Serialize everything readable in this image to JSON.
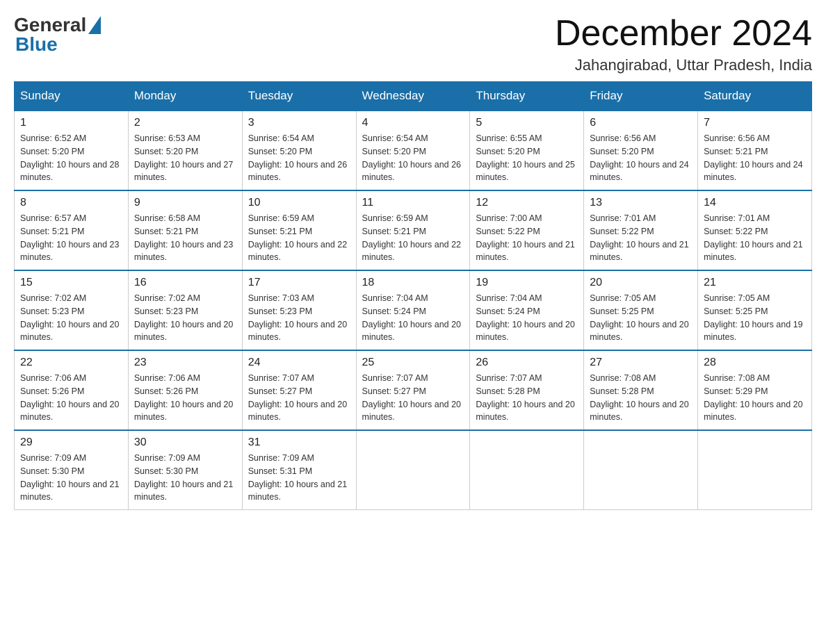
{
  "logo": {
    "general": "General",
    "blue": "Blue"
  },
  "title": {
    "month": "December 2024",
    "location": "Jahangirabad, Uttar Pradesh, India"
  },
  "headers": [
    "Sunday",
    "Monday",
    "Tuesday",
    "Wednesday",
    "Thursday",
    "Friday",
    "Saturday"
  ],
  "weeks": [
    [
      {
        "day": "1",
        "sunrise": "6:52 AM",
        "sunset": "5:20 PM",
        "daylight": "10 hours and 28 minutes."
      },
      {
        "day": "2",
        "sunrise": "6:53 AM",
        "sunset": "5:20 PM",
        "daylight": "10 hours and 27 minutes."
      },
      {
        "day": "3",
        "sunrise": "6:54 AM",
        "sunset": "5:20 PM",
        "daylight": "10 hours and 26 minutes."
      },
      {
        "day": "4",
        "sunrise": "6:54 AM",
        "sunset": "5:20 PM",
        "daylight": "10 hours and 26 minutes."
      },
      {
        "day": "5",
        "sunrise": "6:55 AM",
        "sunset": "5:20 PM",
        "daylight": "10 hours and 25 minutes."
      },
      {
        "day": "6",
        "sunrise": "6:56 AM",
        "sunset": "5:20 PM",
        "daylight": "10 hours and 24 minutes."
      },
      {
        "day": "7",
        "sunrise": "6:56 AM",
        "sunset": "5:21 PM",
        "daylight": "10 hours and 24 minutes."
      }
    ],
    [
      {
        "day": "8",
        "sunrise": "6:57 AM",
        "sunset": "5:21 PM",
        "daylight": "10 hours and 23 minutes."
      },
      {
        "day": "9",
        "sunrise": "6:58 AM",
        "sunset": "5:21 PM",
        "daylight": "10 hours and 23 minutes."
      },
      {
        "day": "10",
        "sunrise": "6:59 AM",
        "sunset": "5:21 PM",
        "daylight": "10 hours and 22 minutes."
      },
      {
        "day": "11",
        "sunrise": "6:59 AM",
        "sunset": "5:21 PM",
        "daylight": "10 hours and 22 minutes."
      },
      {
        "day": "12",
        "sunrise": "7:00 AM",
        "sunset": "5:22 PM",
        "daylight": "10 hours and 21 minutes."
      },
      {
        "day": "13",
        "sunrise": "7:01 AM",
        "sunset": "5:22 PM",
        "daylight": "10 hours and 21 minutes."
      },
      {
        "day": "14",
        "sunrise": "7:01 AM",
        "sunset": "5:22 PM",
        "daylight": "10 hours and 21 minutes."
      }
    ],
    [
      {
        "day": "15",
        "sunrise": "7:02 AM",
        "sunset": "5:23 PM",
        "daylight": "10 hours and 20 minutes."
      },
      {
        "day": "16",
        "sunrise": "7:02 AM",
        "sunset": "5:23 PM",
        "daylight": "10 hours and 20 minutes."
      },
      {
        "day": "17",
        "sunrise": "7:03 AM",
        "sunset": "5:23 PM",
        "daylight": "10 hours and 20 minutes."
      },
      {
        "day": "18",
        "sunrise": "7:04 AM",
        "sunset": "5:24 PM",
        "daylight": "10 hours and 20 minutes."
      },
      {
        "day": "19",
        "sunrise": "7:04 AM",
        "sunset": "5:24 PM",
        "daylight": "10 hours and 20 minutes."
      },
      {
        "day": "20",
        "sunrise": "7:05 AM",
        "sunset": "5:25 PM",
        "daylight": "10 hours and 20 minutes."
      },
      {
        "day": "21",
        "sunrise": "7:05 AM",
        "sunset": "5:25 PM",
        "daylight": "10 hours and 19 minutes."
      }
    ],
    [
      {
        "day": "22",
        "sunrise": "7:06 AM",
        "sunset": "5:26 PM",
        "daylight": "10 hours and 20 minutes."
      },
      {
        "day": "23",
        "sunrise": "7:06 AM",
        "sunset": "5:26 PM",
        "daylight": "10 hours and 20 minutes."
      },
      {
        "day": "24",
        "sunrise": "7:07 AM",
        "sunset": "5:27 PM",
        "daylight": "10 hours and 20 minutes."
      },
      {
        "day": "25",
        "sunrise": "7:07 AM",
        "sunset": "5:27 PM",
        "daylight": "10 hours and 20 minutes."
      },
      {
        "day": "26",
        "sunrise": "7:07 AM",
        "sunset": "5:28 PM",
        "daylight": "10 hours and 20 minutes."
      },
      {
        "day": "27",
        "sunrise": "7:08 AM",
        "sunset": "5:28 PM",
        "daylight": "10 hours and 20 minutes."
      },
      {
        "day": "28",
        "sunrise": "7:08 AM",
        "sunset": "5:29 PM",
        "daylight": "10 hours and 20 minutes."
      }
    ],
    [
      {
        "day": "29",
        "sunrise": "7:09 AM",
        "sunset": "5:30 PM",
        "daylight": "10 hours and 21 minutes."
      },
      {
        "day": "30",
        "sunrise": "7:09 AM",
        "sunset": "5:30 PM",
        "daylight": "10 hours and 21 minutes."
      },
      {
        "day": "31",
        "sunrise": "7:09 AM",
        "sunset": "5:31 PM",
        "daylight": "10 hours and 21 minutes."
      },
      null,
      null,
      null,
      null
    ]
  ],
  "day_labels": {
    "sunrise": "Sunrise: ",
    "sunset": "Sunset: ",
    "daylight": "Daylight: "
  }
}
